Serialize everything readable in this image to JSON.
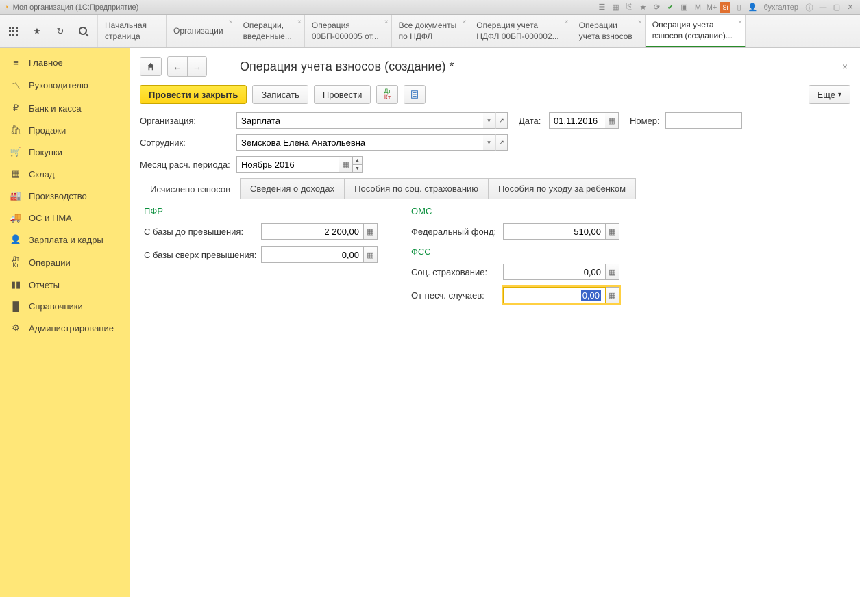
{
  "system": {
    "title": "Моя организация (1С:Предприятие)",
    "user": "бухгалтер"
  },
  "tabs": [
    {
      "l1": "Начальная",
      "l2": "страница"
    },
    {
      "l1": "Организации",
      "l2": ""
    },
    {
      "l1": "Операции,",
      "l2": "введенные..."
    },
    {
      "l1": "Операция",
      "l2": "00БП-000005 от..."
    },
    {
      "l1": "Все документы",
      "l2": "по НДФЛ"
    },
    {
      "l1": "Операция учета",
      "l2": "НДФЛ 00БП-000002..."
    },
    {
      "l1": "Операции",
      "l2": "учета взносов"
    },
    {
      "l1": "Операция учета",
      "l2": "взносов (создание)..."
    }
  ],
  "nav": [
    {
      "icon": "menu",
      "label": "Главное"
    },
    {
      "icon": "chart",
      "label": "Руководителю"
    },
    {
      "icon": "ruble",
      "label": "Банк и касса"
    },
    {
      "icon": "bag",
      "label": "Продажи"
    },
    {
      "icon": "cart",
      "label": "Покупки"
    },
    {
      "icon": "boxes",
      "label": "Склад"
    },
    {
      "icon": "factory",
      "label": "Производство"
    },
    {
      "icon": "truck",
      "label": "ОС и НМА"
    },
    {
      "icon": "person",
      "label": "Зарплата и кадры"
    },
    {
      "icon": "dtKt",
      "label": "Операции"
    },
    {
      "icon": "bars",
      "label": "Отчеты"
    },
    {
      "icon": "books",
      "label": "Справочники"
    },
    {
      "icon": "gear",
      "label": "Администрирование"
    }
  ],
  "page": {
    "title": "Операция учета взносов (создание) *"
  },
  "actions": {
    "postAndClose": "Провести и закрыть",
    "save": "Записать",
    "post": "Провести",
    "more": "Еще"
  },
  "form": {
    "orgLabel": "Организация:",
    "orgValue": "Зарплата",
    "dateLabel": "Дата:",
    "dateValue": "01.11.2016",
    "numberLabel": "Номер:",
    "numberValue": "",
    "empLabel": "Сотрудник:",
    "empValue": "Земскова Елена Анатольевна",
    "periodLabel": "Месяц расч. периода:",
    "periodValue": "Ноябрь 2016"
  },
  "subtabs": [
    "Исчислено взносов",
    "Сведения о доходах",
    "Пособия по соц. страхованию",
    "Пособия по уходу за ребенком"
  ],
  "calc": {
    "pfr": {
      "title": "ПФР",
      "baseBeforeLabel": "С базы до превышения:",
      "baseBeforeValue": "2 200,00",
      "baseOverLabel": "С базы сверх превышения:",
      "baseOverValue": "0,00"
    },
    "oms": {
      "title": "ОМС",
      "fedLabel": "Федеральный фонд:",
      "fedValue": "510,00"
    },
    "fss": {
      "title": "ФСС",
      "socLabel": "Соц. страхование:",
      "socValue": "0,00",
      "accLabel": "От несч. случаев:",
      "accValue": "0,00"
    }
  }
}
